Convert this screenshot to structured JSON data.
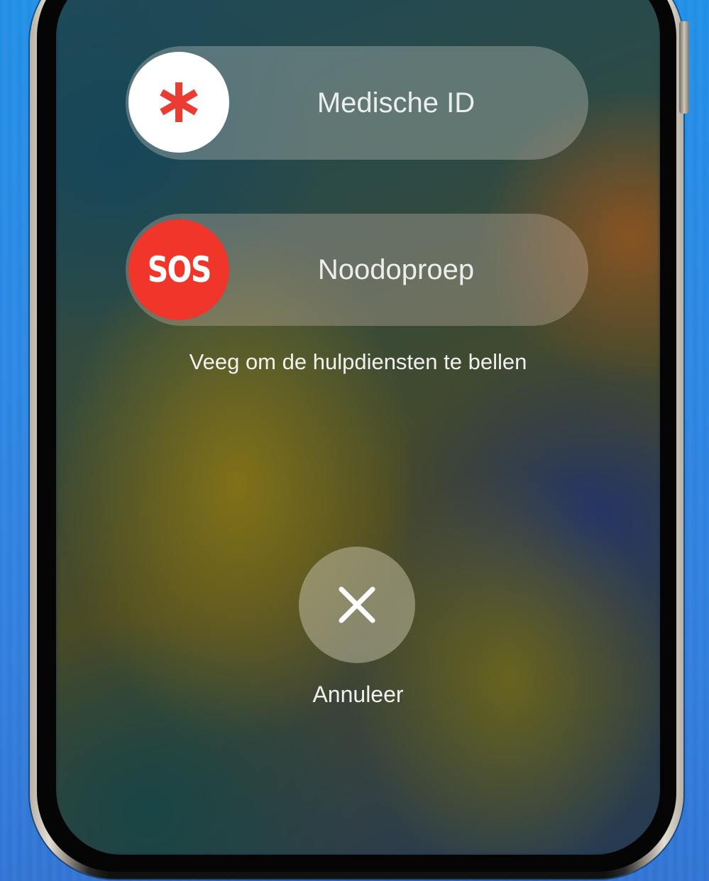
{
  "emergency_screen": {
    "medical_id": {
      "label": "Medische ID",
      "icon": "asterisk-icon",
      "icon_color": "#ec3b30"
    },
    "emergency_sos": {
      "label": "Noodoproep",
      "knob_text": "SOS",
      "knob_color": "#f0352b"
    },
    "hint_text": "Veeg om de hulpdiensten te bellen",
    "cancel": {
      "label": "Annuleer",
      "icon": "close-icon"
    }
  }
}
